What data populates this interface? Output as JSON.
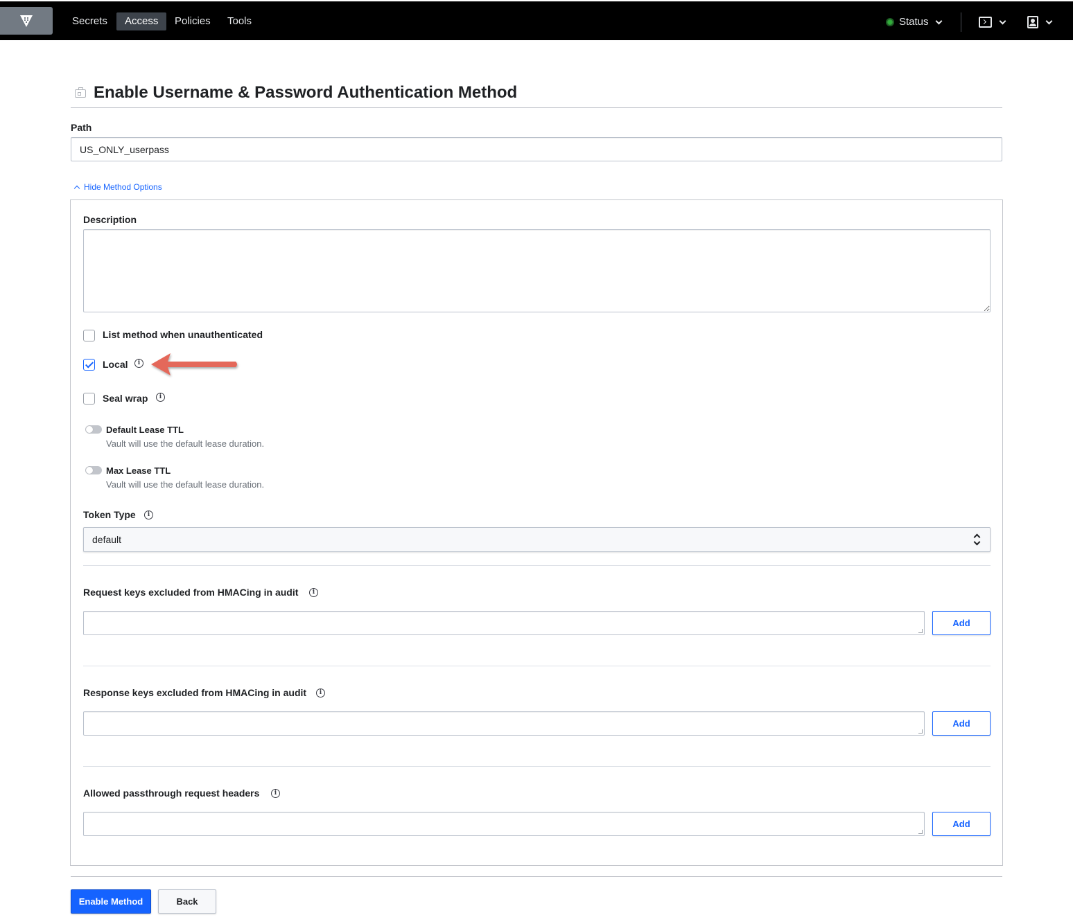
{
  "nav": {
    "logo_icon": "vault-logo-icon",
    "links": [
      "Secrets",
      "Access",
      "Policies",
      "Tools"
    ],
    "active_link": "Access",
    "status_label": "Status",
    "status_color": "#2eb039",
    "console_icon": "terminal-icon",
    "user_icon": "user-icon"
  },
  "page": {
    "title": "Enable Username & Password Authentication Method",
    "title_icon": "auth-method-icon"
  },
  "path": {
    "label": "Path",
    "value": "US_ONLY_userpass"
  },
  "method_options": {
    "toggle_label": "Hide Method Options",
    "description_label": "Description",
    "description_value": "",
    "list_unauthenticated": {
      "label": "List method when unauthenticated",
      "checked": false
    },
    "local": {
      "label": "Local",
      "checked": true
    },
    "seal_wrap": {
      "label": "Seal wrap",
      "checked": false
    },
    "default_lease_ttl": {
      "label": "Default Lease TTL",
      "help": "Vault will use the default lease duration.",
      "enabled": false
    },
    "max_lease_ttl": {
      "label": "Max Lease TTL",
      "help": "Vault will use the default lease duration.",
      "enabled": false
    },
    "token_type": {
      "label": "Token Type",
      "selected": "default"
    },
    "request_keys": {
      "label": "Request keys excluded from HMACing in audit",
      "value": "",
      "add_label": "Add"
    },
    "response_keys": {
      "label": "Response keys excluded from HMACing in audit",
      "value": "",
      "add_label": "Add"
    },
    "passthrough_headers": {
      "label": "Allowed passthrough request headers",
      "value": "",
      "add_label": "Add"
    }
  },
  "annotation": {
    "arrow_color": "#e4675a"
  },
  "actions": {
    "enable_label": "Enable Method",
    "back_label": "Back",
    "accent": "#1563ff"
  }
}
